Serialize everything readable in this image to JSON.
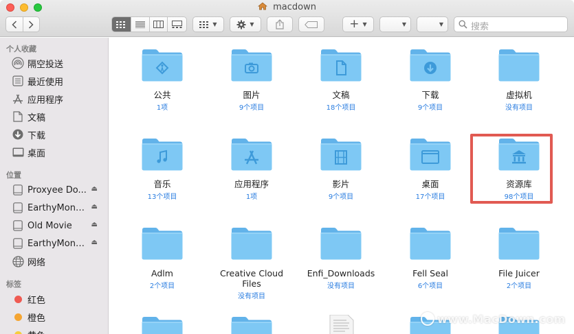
{
  "window": {
    "title": "macdown"
  },
  "toolbar": {
    "search_placeholder": "搜索",
    "add_label": "+"
  },
  "sidebar": {
    "favorites_header": "个人收藏",
    "favorites": [
      {
        "label": "隔空投送",
        "icon": "airdrop-icon"
      },
      {
        "label": "最近使用",
        "icon": "recents-icon"
      },
      {
        "label": "应用程序",
        "icon": "applications-icon"
      },
      {
        "label": "文稿",
        "icon": "document-icon"
      },
      {
        "label": "下载",
        "icon": "download-icon"
      },
      {
        "label": "桌面",
        "icon": "desktop-icon"
      }
    ],
    "locations_header": "位置",
    "locations": [
      {
        "label": "Proxyee Do...",
        "icon": "disk-icon"
      },
      {
        "label": "EarthyMono...",
        "icon": "disk-icon"
      },
      {
        "label": "Old Movie",
        "icon": "disk-icon"
      },
      {
        "label": "EarthyMono...",
        "icon": "disk-icon"
      },
      {
        "label": "网络",
        "icon": "network-icon"
      }
    ],
    "tags_header": "标签",
    "tags": [
      {
        "label": "红色",
        "color": "#ef5a52"
      },
      {
        "label": "橙色",
        "color": "#f5a532"
      },
      {
        "label": "黄色",
        "color": "#f6cd3c"
      }
    ]
  },
  "files": [
    {
      "name": "公共",
      "count": "1项",
      "icon": "public-folder-icon"
    },
    {
      "name": "图片",
      "count": "9个项目",
      "icon": "pictures-folder-icon"
    },
    {
      "name": "文稿",
      "count": "18个项目",
      "icon": "documents-folder-icon"
    },
    {
      "name": "下载",
      "count": "9个项目",
      "icon": "downloads-folder-icon"
    },
    {
      "name": "虚拟机",
      "count": "没有项目",
      "icon": "folder-icon"
    },
    {
      "name": "音乐",
      "count": "13个项目",
      "icon": "music-folder-icon"
    },
    {
      "name": "应用程序",
      "count": "1项",
      "icon": "applications-folder-icon"
    },
    {
      "name": "影片",
      "count": "9个项目",
      "icon": "movies-folder-icon"
    },
    {
      "name": "桌面",
      "count": "17个项目",
      "icon": "desktop-folder-icon"
    },
    {
      "name": "资源库",
      "count": "98个项目",
      "icon": "library-folder-icon"
    },
    {
      "name": "Adlm",
      "count": "2个项目",
      "icon": "folder-icon"
    },
    {
      "name": "Creative Cloud Files",
      "count": "没有项目",
      "icon": "folder-icon"
    },
    {
      "name": "Enfi_Downloads",
      "count": "没有项目",
      "icon": "folder-icon"
    },
    {
      "name": "Fell Seal",
      "count": "6个项目",
      "icon": "folder-icon"
    },
    {
      "name": "File Juicer",
      "count": "2个项目",
      "icon": "folder-icon"
    }
  ],
  "colors": {
    "folder": "#7ec8f4",
    "folder_dark": "#5fb3ea",
    "highlight": "#e15a52",
    "count_text": "#2a7de0"
  },
  "watermark": "www.MacDown.com"
}
